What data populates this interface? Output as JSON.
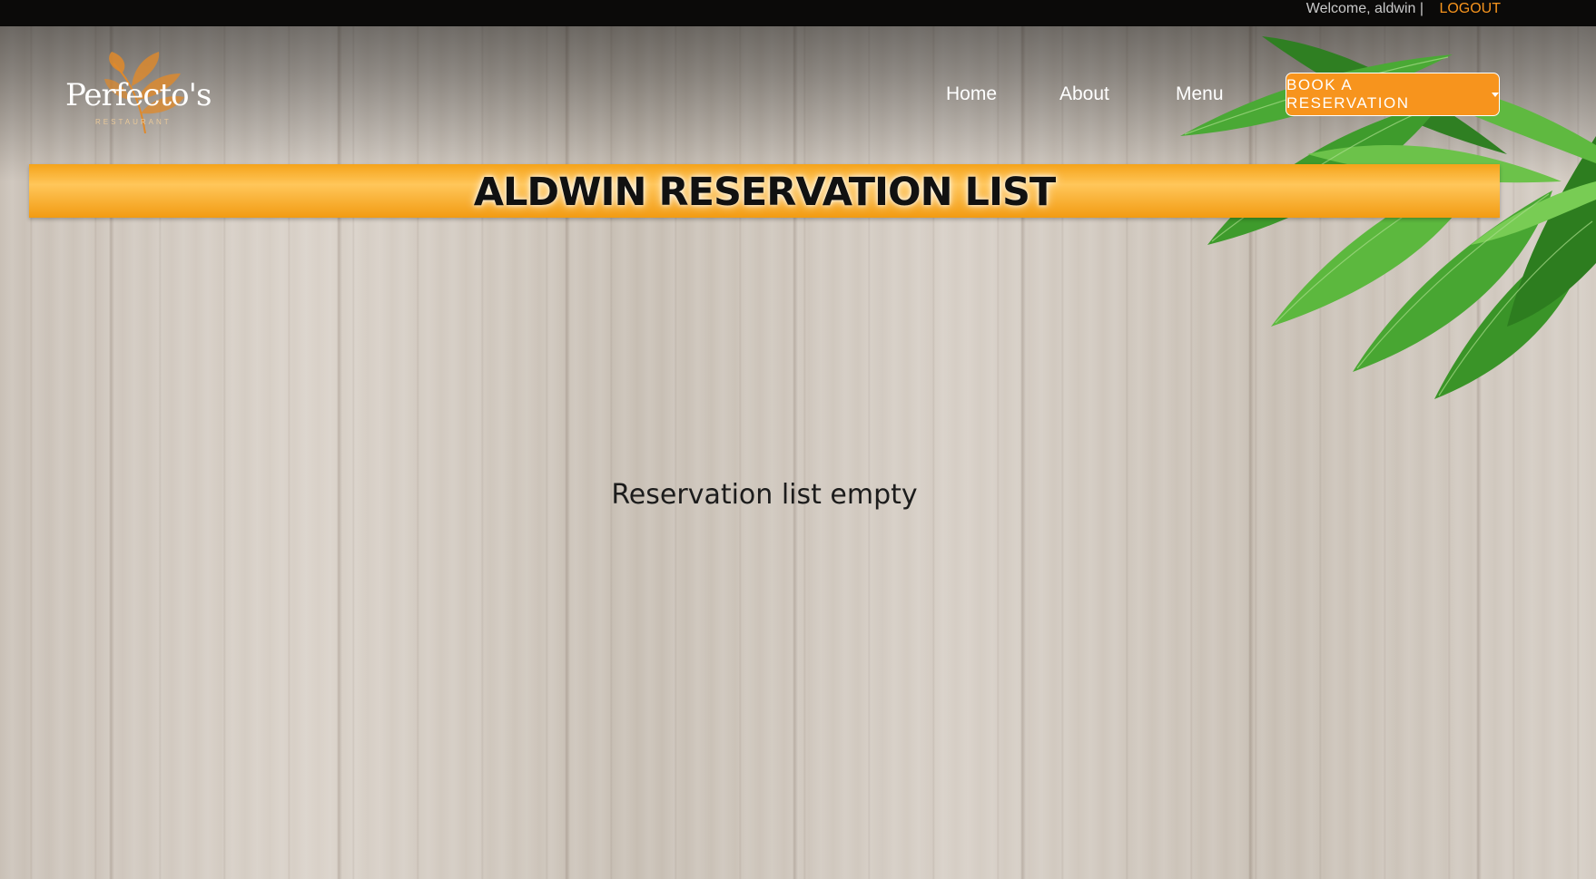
{
  "topbar": {
    "welcome": "Welcome, aldwin |",
    "logout_label": "LOGOUT"
  },
  "logo": {
    "name": "Perfecto's",
    "subtitle": "RESTAURANT"
  },
  "nav": {
    "items": [
      {
        "label": "Home"
      },
      {
        "label": "About"
      },
      {
        "label": "Menu"
      }
    ],
    "book_label": "BOOK A RESERVATION"
  },
  "banner": {
    "title": "ALDWIN RESERVATION LIST"
  },
  "content": {
    "empty_message": "Reservation list empty"
  },
  "icons": {
    "logo_leaf": "leaf-icon",
    "dropdown": "caret-down-icon",
    "decoration": "leaves-decoration"
  },
  "colors": {
    "accent": "#f7941d",
    "topbar": "#0b0a09",
    "leaf": "#3f9e2b"
  }
}
